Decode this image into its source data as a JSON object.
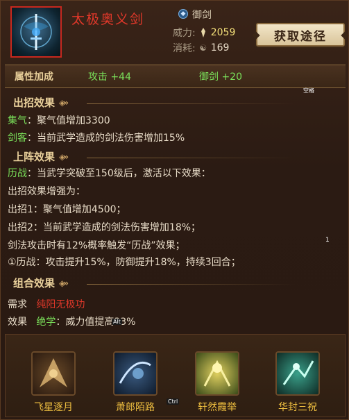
{
  "header": {
    "skill_name": "太极奥义剑",
    "type_label": "御剑",
    "power_label": "威力:",
    "power_value": "2059",
    "cost_label": "消耗:",
    "cost_value": "169",
    "acquire_button": "获取途径"
  },
  "attributes": {
    "title": "属性加成",
    "attr1": "攻击 +44",
    "attr2": "御剑 +20",
    "corner_hint": "空格"
  },
  "on_cast": {
    "title": "出招效果",
    "line1_kw": "集气",
    "line1_text": "：聚气值增加3300",
    "line2_kw": "剑客",
    "line2_text": "：当前武学造成的剑法伤害增加15%"
  },
  "equip": {
    "title": "上阵效果",
    "line1_kw": "历战",
    "line1_text": "：当武学突破至150级后，激活以下效果：",
    "line2": "出招效果增强为：",
    "line3": "出招1：聚气值增加4500；",
    "line4": "出招2：当前武学造成的剑法伤害增加18%；",
    "line5": "剑法攻击时有12%概率触发“历战”效果；",
    "line6": "①历战：攻击提升15%，防御提升18%，持续3回合；",
    "side_badge": "1"
  },
  "combo": {
    "title": "组合效果",
    "req_label": "需求",
    "req_value": "纯阳无极功",
    "effect_label": "效果",
    "effect_kw": "绝学",
    "effect_text": "：威力值提高33%",
    "float_tag": "Alt",
    "items": [
      {
        "name": "飞星逐月",
        "icon": "flying-star-icon"
      },
      {
        "name": "萧郎陌路",
        "icon": "stranger-path-icon"
      },
      {
        "name": "轩然霞举",
        "icon": "rising-glow-icon"
      },
      {
        "name": "华封三祝",
        "icon": "triple-blessing-icon"
      }
    ],
    "ctrl_tag": "Ctrl"
  },
  "colors": {
    "skill_name": "#e2382a",
    "keyword": "#7ae05a",
    "section_title": "#e8cf9a",
    "combo_label": "#f0c040"
  }
}
